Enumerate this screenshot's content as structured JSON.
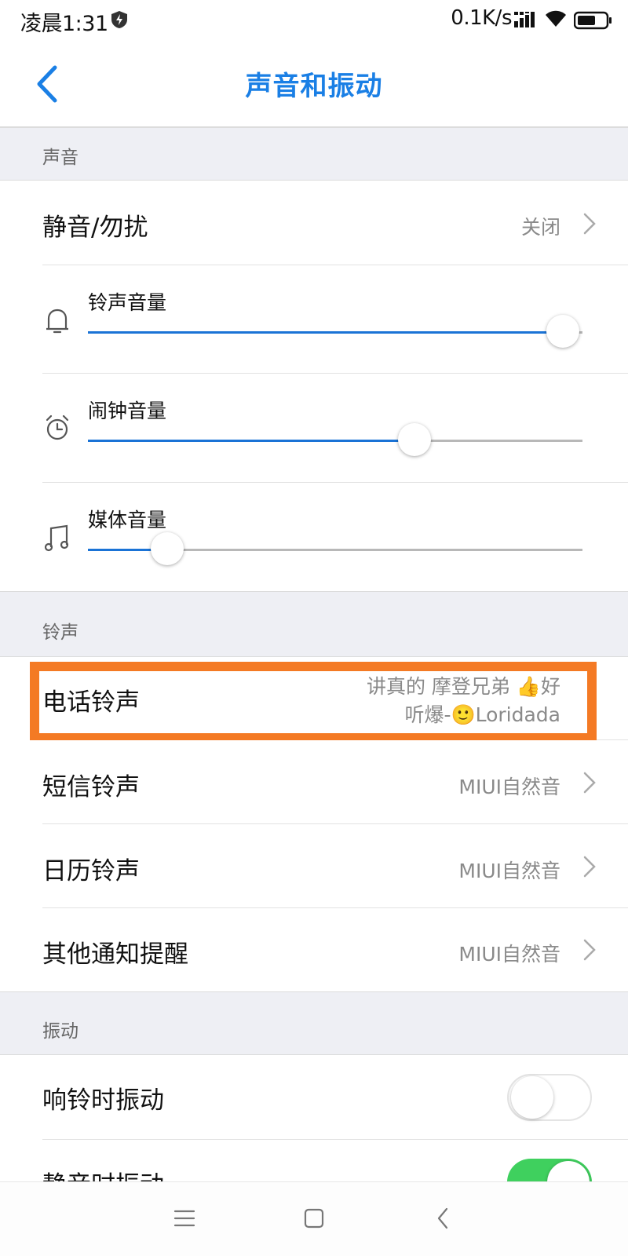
{
  "status_bar": {
    "time": "凌晨1:31",
    "net_speed": "0.1K/s",
    "icons": [
      "shield-icon",
      "signal-icon",
      "wifi-icon",
      "battery-icon"
    ]
  },
  "header": {
    "title": "声音和振动",
    "back_icon": "back-arrow-icon"
  },
  "sections": {
    "sound": {
      "header": "声音",
      "dnd": {
        "label": "静音/勿扰",
        "value": "关闭"
      },
      "ring_volume": {
        "label": "铃声音量",
        "icon": "bell-icon",
        "level": 0.96
      },
      "alarm_volume": {
        "label": "闹钟音量",
        "icon": "alarm-clock-icon",
        "level": 0.66
      },
      "media_volume": {
        "label": "媒体音量",
        "icon": "music-note-icon",
        "level": 0.16
      }
    },
    "ringtone": {
      "header": "铃声",
      "phone": {
        "label": "电话铃声",
        "value_line1": "讲真的 摩登兄弟 👍好",
        "value_line2": "听爆-🙂Loridada"
      },
      "sms": {
        "label": "短信铃声",
        "value": "MIUI自然音"
      },
      "calendar": {
        "label": "日历铃声",
        "value": "MIUI自然音"
      },
      "other": {
        "label": "其他通知提醒",
        "value": "MIUI自然音"
      }
    },
    "vibration": {
      "header": "振动",
      "vibrate_on_ring": {
        "label": "响铃时振动",
        "enabled": false
      },
      "vibrate_on_silent": {
        "label": "静音时振动",
        "enabled": true
      }
    }
  },
  "colors": {
    "accent": "#1a7fe5",
    "highlight": "#f47a24",
    "toggle_on": "#3fd05e",
    "section_bg": "#eeeff4"
  },
  "nav_bar": {
    "icons": [
      "menu-icon",
      "home-icon",
      "back-icon"
    ]
  }
}
